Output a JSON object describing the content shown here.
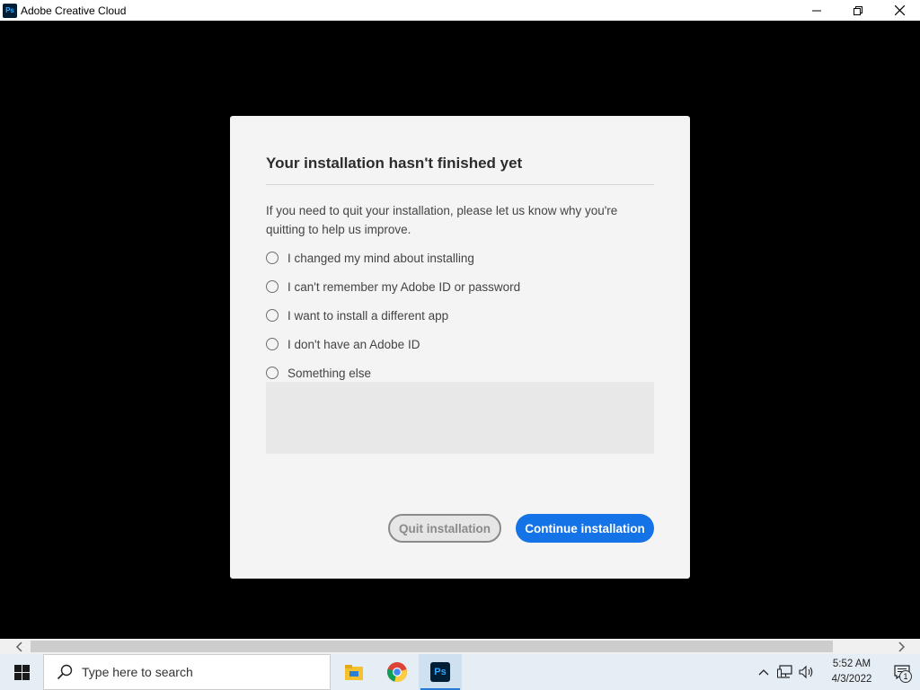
{
  "window": {
    "title": "Adobe Creative Cloud",
    "app_icon_text": "Ps"
  },
  "dialog": {
    "title": "Your installation hasn't finished yet",
    "description": "If you need to quit your installation, please let us know why you're quitting to help us improve.",
    "options": [
      {
        "label": "I changed my mind about installing",
        "selected": false
      },
      {
        "label": "I can't remember my Adobe ID or password",
        "selected": false
      },
      {
        "label": "I want to install a different app",
        "selected": false
      },
      {
        "label": "I don't have an Adobe ID",
        "selected": false
      },
      {
        "label": "Something else",
        "selected": false
      }
    ],
    "feedback_value": "",
    "quit_label": "Quit installation",
    "continue_label": "Continue installation"
  },
  "taskbar": {
    "search_placeholder": "Type here to search",
    "apps": [
      {
        "name": "file-explorer",
        "active": false
      },
      {
        "name": "chrome",
        "active": false
      },
      {
        "name": "photoshop",
        "label": "Ps",
        "active": true
      }
    ],
    "clock_time": "5:52 AM",
    "clock_date": "4/3/2022",
    "notification_count": "1"
  },
  "colors": {
    "accent": "#1473e6",
    "dialog_bg": "#f4f4f4",
    "backdrop": "#000000"
  }
}
